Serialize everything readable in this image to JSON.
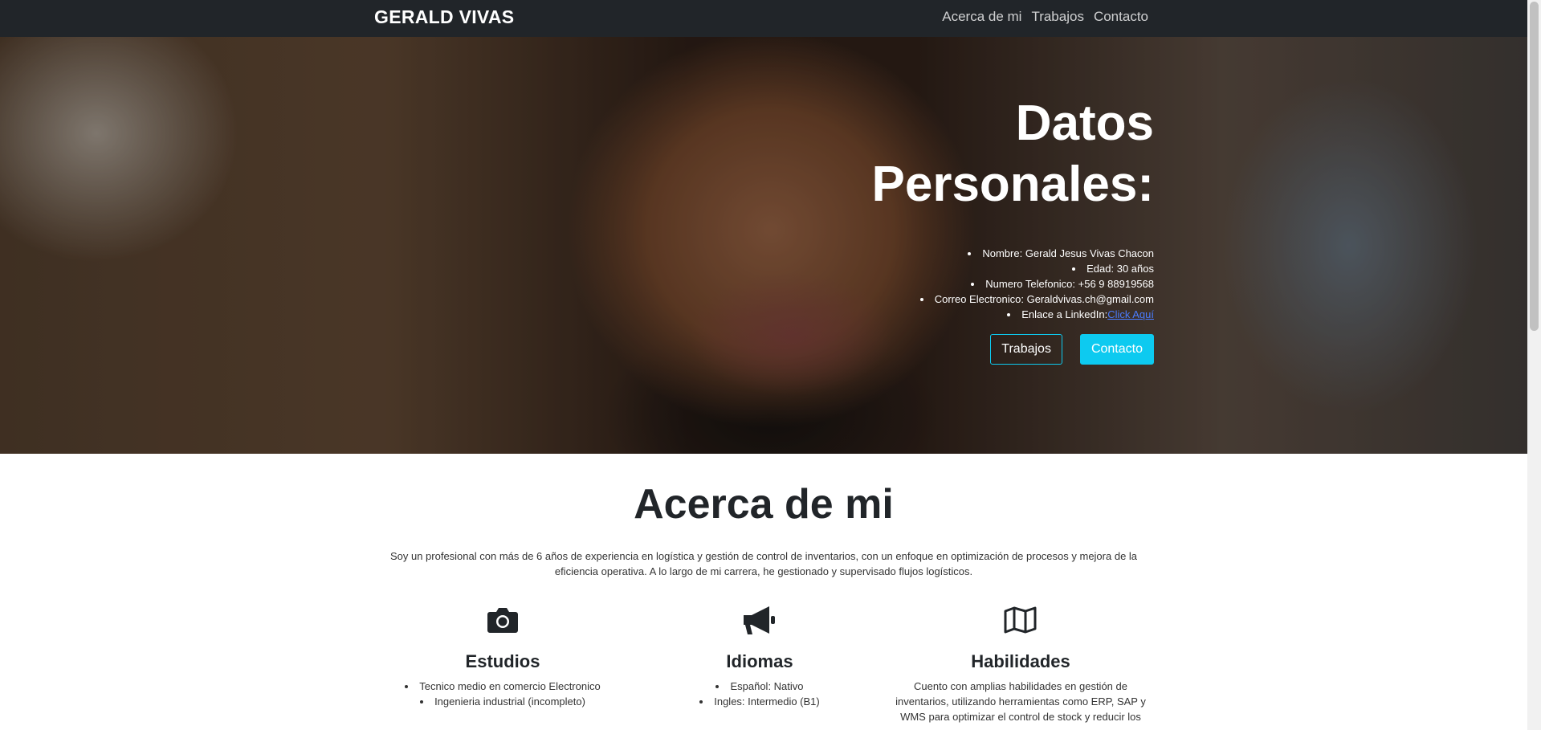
{
  "navbar": {
    "brand": "GERALD VIVAS",
    "links": [
      "Acerca de mi",
      "Trabajos",
      "Contacto"
    ]
  },
  "hero": {
    "title_line1": "Datos",
    "title_line2": "Personales:",
    "info": [
      "Nombre: Gerald Jesus Vivas Chacon",
      "Edad: 30 años",
      "Numero Telefonico: +56 9 88919568",
      "Correo Electronico: Geraldvivas.ch@gmail.com",
      "Enlace a LinkedIn:"
    ],
    "linkedin_link": "Click Aquí",
    "button_works": "Trabajos",
    "button_contact": "Contacto"
  },
  "about": {
    "title": "Acerca de mi",
    "text": "Soy un profesional con más de 6 años de experiencia en logística y gestión de control de inventarios, con un enfoque en optimización de procesos y mejora de la eficiencia operativa. A lo largo de mi carrera, he gestionado y supervisado flujos logísticos.",
    "features": [
      {
        "icon": "camera-icon",
        "title": "Estudios",
        "items": [
          "Tecnico medio en comercio Electronico",
          "Ingenieria industrial (incompleto)"
        ]
      },
      {
        "icon": "megaphone-icon",
        "title": "Idiomas",
        "items": [
          "Español: Nativo",
          "Ingles: Intermedio (B1)"
        ]
      },
      {
        "icon": "map-icon",
        "title": "Habilidades",
        "text": "Cuento con amplias habilidades en gestión de inventarios, utilizando herramientas como ERP, SAP y WMS para optimizar el control de stock y reducir los"
      }
    ]
  },
  "colors": {
    "navbar": "#212529",
    "accent": "#0dcaf0",
    "link": "#4a7cff"
  }
}
